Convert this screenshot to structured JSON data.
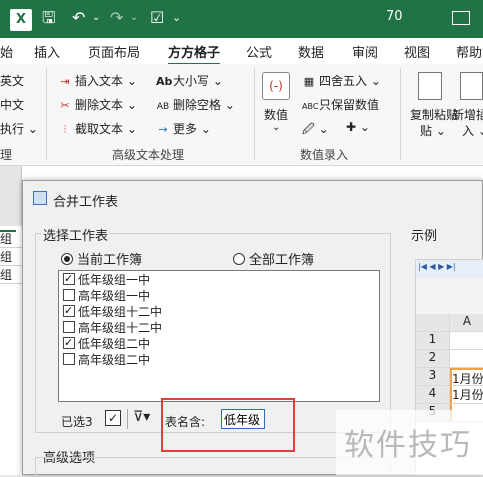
{
  "titlebar": {
    "qat_icons": [
      "excel-icon",
      "save-icon",
      "undo-icon",
      "redo-icon",
      "checkbox-icon"
    ],
    "title_text": "70",
    "ribbon_display_icon": "ribbon-display-icon"
  },
  "tabs": [
    "始",
    "插入",
    "页面布局",
    "方方格子",
    "公式",
    "数据",
    "审阅",
    "视图",
    "帮助"
  ],
  "active_tab": "方方格子",
  "ribbon": {
    "left_items": [
      "英文",
      "中文",
      "执行 ⌄"
    ],
    "text_group": {
      "col1": [
        "插入文本 ⌄",
        "删除文本 ⌄",
        "截取文本 ⌄"
      ],
      "col2": [
        "大小写 ⌄",
        "删除空格 ⌄",
        "更多 ⌄"
      ],
      "label": "高级文本处理"
    },
    "number_group": {
      "number_btn": "数值",
      "round_btn": "四舍五入 ⌄",
      "keep_btn": "只保留数值",
      "label": "数值录入"
    },
    "copy_paste": "复制粘贴",
    "copy_paste_sub": "贴 ⌄",
    "new_insert": "新增插",
    "new_insert_sub": "入 ⌄",
    "left_group_label": "理"
  },
  "sheet": {
    "col_header": "",
    "cells": [
      "组",
      "组",
      "组"
    ]
  },
  "dialog": {
    "title": "合并工作表",
    "select_section": "选择工作表",
    "current_workbook": "当前工作簿",
    "all_workbooks": "全部工作簿",
    "sheets": [
      {
        "name": "低年级组一中",
        "checked": true
      },
      {
        "name": "高年级组一中",
        "checked": false
      },
      {
        "name": "低年级组十二中",
        "checked": true
      },
      {
        "name": "高年级组十二中",
        "checked": false
      },
      {
        "name": "低年级组二中",
        "checked": true
      },
      {
        "name": "高年级组二中",
        "checked": false
      }
    ],
    "selected_count": "已选3",
    "filter_label": "表名含:",
    "filter_value": "低年级",
    "advanced_section": "高级选项",
    "example_section": "示例",
    "example": {
      "col_a": "A",
      "rows": [
        "1",
        "2",
        "3",
        "4",
        "5"
      ],
      "values": [
        "",
        "",
        "1月份",
        "1月份",
        ""
      ]
    }
  },
  "watermark": "软件技巧",
  "colors": {
    "excel_green": "#217346",
    "highlight_red": "#e0403a",
    "example_orange": "#f0a34a"
  }
}
